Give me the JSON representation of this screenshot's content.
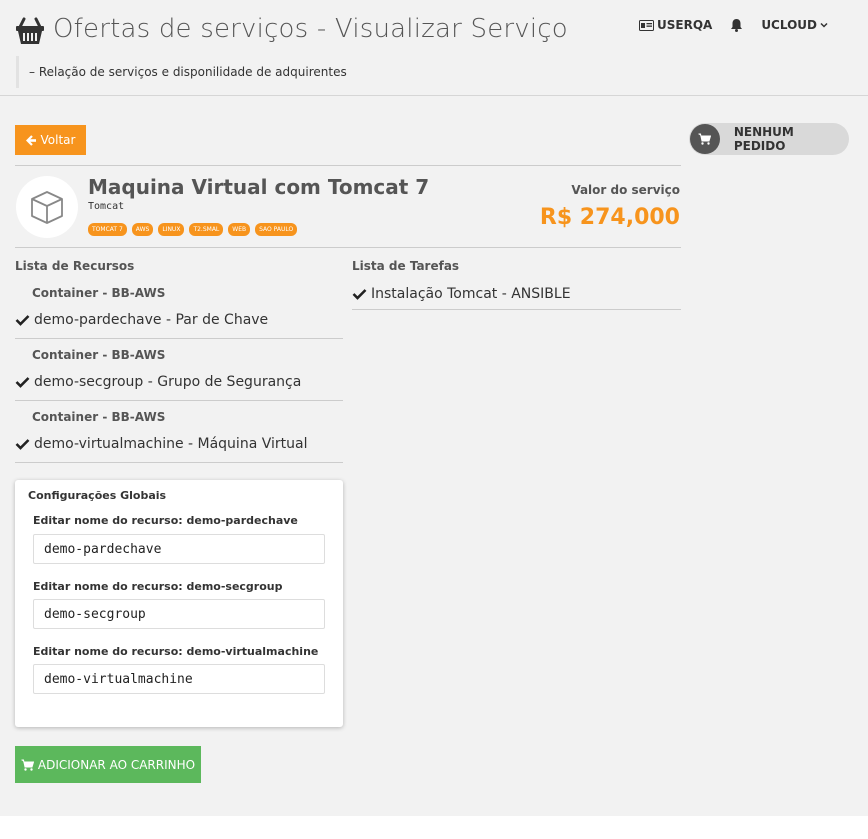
{
  "header": {
    "title": "Ofertas de serviços - Visualizar Serviço",
    "subtitle": "– Relação de serviços e disponilidade de adquirentes",
    "user_label": "USERQA",
    "org_label": "UCLOUD"
  },
  "actions": {
    "back_label": "Voltar",
    "order_status": "NENHUM PEDIDO",
    "add_to_cart_label": "ADICIONAR AO CARRINHO"
  },
  "product": {
    "name": "Maquina Virtual com Tomcat 7",
    "subtitle": "Tomcat",
    "tags": [
      "TOMCAT 7",
      "AWS",
      "LINUX",
      "T2.SMAL",
      "WEB",
      "SAO PAULO"
    ],
    "price_label": "Valor do serviço",
    "price": "R$ 274,000"
  },
  "resources": {
    "heading": "Lista de Recursos",
    "items": [
      {
        "container": "Container - BB-AWS",
        "label": "demo-pardechave - Par de Chave"
      },
      {
        "container": "Container - BB-AWS",
        "label": "demo-secgroup - Grupo de Segurança"
      },
      {
        "container": "Container - BB-AWS",
        "label": "demo-virtualmachine - Máquina Virtual"
      }
    ]
  },
  "tasks": {
    "heading": "Lista de Tarefas",
    "items": [
      {
        "label": "Instalação Tomcat - ANSIBLE"
      }
    ]
  },
  "config": {
    "title": "Configurações Globais",
    "fields": [
      {
        "label": "Editar nome do recurso: demo-pardechave",
        "value": "demo-pardechave"
      },
      {
        "label": "Editar nome do recurso: demo-secgroup",
        "value": "demo-secgroup"
      },
      {
        "label": "Editar nome do recurso: demo-virtualmachine",
        "value": "demo-virtualmachine"
      }
    ]
  },
  "colors": {
    "accent": "#f7941d",
    "success": "#5cb85c",
    "background": "#f2f2f2"
  },
  "icons": {
    "brand": "basket-icon",
    "user": "id-card-icon",
    "notifications": "bell-icon",
    "org_menu": "chevron-down-icon",
    "back": "arrow-left-icon",
    "cart": "cart-icon",
    "product": "cube-icon",
    "check": "check-icon"
  }
}
